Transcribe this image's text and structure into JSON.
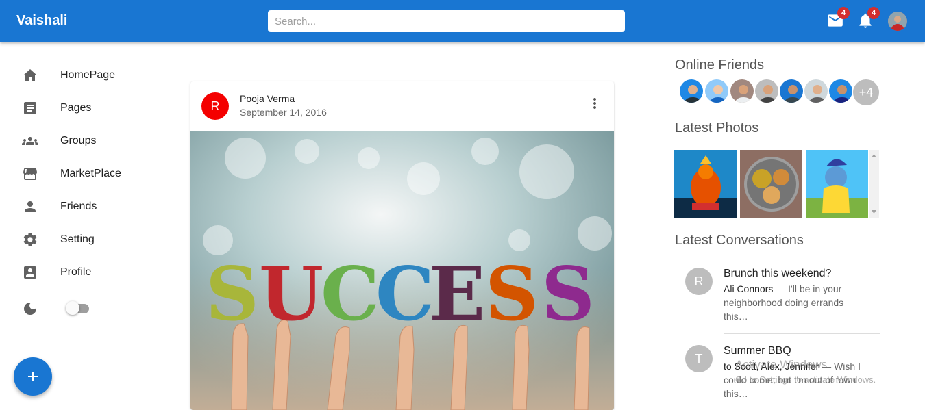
{
  "header": {
    "brand": "Vaishali",
    "search_placeholder": "Search...",
    "mail_count": "4",
    "notification_count": "4"
  },
  "sidebar": {
    "items": [
      {
        "label": "HomePage",
        "icon": "home-icon"
      },
      {
        "label": "Pages",
        "icon": "article-icon"
      },
      {
        "label": "Groups",
        "icon": "groups-icon"
      },
      {
        "label": "MarketPlace",
        "icon": "storefront-icon"
      },
      {
        "label": "Friends",
        "icon": "person-icon"
      },
      {
        "label": "Setting",
        "icon": "settings-icon"
      },
      {
        "label": "Profile",
        "icon": "account-box-icon"
      }
    ],
    "theme_toggle": {
      "icon": "dark-mode-icon",
      "checked": false
    }
  },
  "post": {
    "avatar_letter": "R",
    "author": "Pooja Verma",
    "date": "September 14, 2016",
    "image_text": "SUCCESS"
  },
  "right": {
    "online_title": "Online Friends",
    "online_more": "+4",
    "photos_title": "Latest Photos",
    "conversations_title": "Latest Conversations",
    "conversations": [
      {
        "avatar": "R",
        "title": "Brunch this weekend?",
        "sender": "Ali Connors",
        "preview": " — I'll be in your neighborhood doing errands this…"
      },
      {
        "avatar": "T",
        "title": "Summer BBQ",
        "sender": "to Scott, Alex, Jennifer",
        "preview": " — Wish I could come, but I'm out of town this…"
      }
    ]
  },
  "watermark": {
    "title": "Activate Windows",
    "subtitle": "Go to Settings to activate Windows."
  },
  "colors": {
    "primary": "#1976d2",
    "badge": "#d32f2f",
    "post_avatar": "#f40000"
  }
}
